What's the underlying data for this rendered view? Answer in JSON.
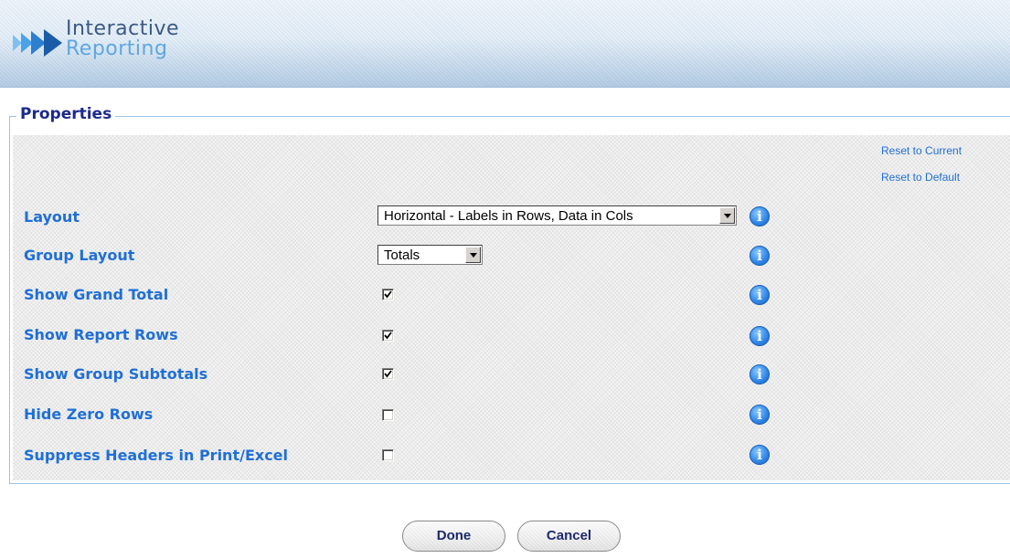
{
  "header": {
    "logo_line1": "Interactive",
    "logo_line2": "Reporting"
  },
  "properties": {
    "title": "Properties",
    "reset_current": "Reset to Current",
    "reset_default": "Reset to Default",
    "rows": [
      {
        "label": "Layout",
        "control": "select",
        "value": "Horizontal - Labels in Rows, Data in Cols"
      },
      {
        "label": "Group Layout",
        "control": "select",
        "value": "Totals"
      },
      {
        "label": "Show Grand Total",
        "control": "checkbox",
        "checked": true
      },
      {
        "label": "Show Report Rows",
        "control": "checkbox",
        "checked": true
      },
      {
        "label": "Show Group Subtotals",
        "control": "checkbox",
        "checked": true
      },
      {
        "label": "Hide Zero Rows",
        "control": "checkbox",
        "checked": false
      },
      {
        "label": "Suppress Headers in Print/Excel",
        "control": "checkbox",
        "checked": false
      }
    ],
    "info_glyph": "i"
  },
  "buttons": {
    "done": "Done",
    "cancel": "Cancel"
  },
  "colors": {
    "label": "#1f6fd6",
    "legend": "#1b2a8c",
    "info_icon": "#2f86e6"
  }
}
